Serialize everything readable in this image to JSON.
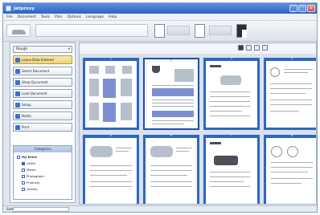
{
  "app": {
    "title": "Jetproxy"
  },
  "menu": [
    "File",
    "Document",
    "Tools",
    "Plan",
    "Options",
    "Language",
    "Help"
  ],
  "sidebar": {
    "dropdown_label": "Rough",
    "items": [
      {
        "label": "Leave Data Entered"
      },
      {
        "label": "Select Document"
      },
      {
        "label": "Show Document"
      },
      {
        "label": "Load Document"
      },
      {
        "label": "Setup"
      },
      {
        "label": "Notify"
      },
      {
        "label": "Print"
      }
    ],
    "categories": {
      "header": "Categories",
      "nodes": [
        {
          "label": "My Drive",
          "root": true
        },
        {
          "label": "Letter",
          "selected": true
        },
        {
          "label": "Memo"
        },
        {
          "label": "Photograph"
        },
        {
          "label": "Products"
        },
        {
          "label": "Quality"
        }
      ]
    }
  },
  "status": {
    "label": "Size"
  },
  "thumbnails": [
    {
      "page": "1"
    },
    {
      "page": "2"
    },
    {
      "page": "3"
    },
    {
      "page": "4"
    },
    {
      "page": "5"
    },
    {
      "page": "6"
    },
    {
      "page": "7"
    },
    {
      "page": "8"
    }
  ],
  "colors": {
    "selection_blue": "#2f66c2",
    "titlebar": "#2c63c9",
    "active_item": "#ecd27a"
  }
}
